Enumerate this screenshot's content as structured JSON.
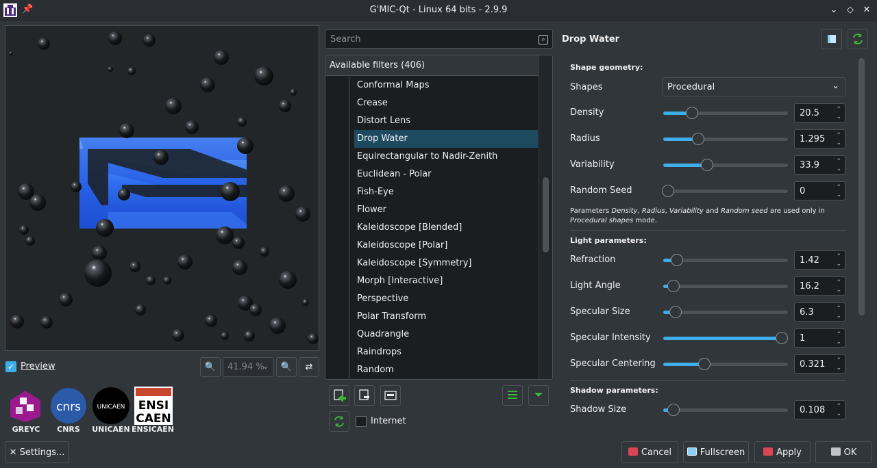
{
  "window": {
    "title": "G'MIC-Qt - Linux 64 bits - 2.9.9"
  },
  "preview": {
    "checkbox_label": "Preview",
    "zoom": "41.94 %",
    "checked": true
  },
  "logos": [
    {
      "label": "GREYC"
    },
    {
      "label": "CNRS"
    },
    {
      "label": "UNICAEN"
    },
    {
      "label": "ENSICAEN"
    }
  ],
  "logo_text": {
    "cnrs": "cnrs",
    "unicaen": "UNICAEN",
    "ensi": "ENSI",
    "caen": "CAEN"
  },
  "settings_label": "Settings...",
  "search": {
    "placeholder": "Search"
  },
  "filters": {
    "header": "Available filters (406)",
    "items": [
      "Conformal Maps",
      "Crease",
      "Distort Lens",
      "Drop Water",
      "Equirectangular to Nadir-Zenith",
      "Euclidean - Polar",
      "Fish-Eye",
      "Flower",
      "Kaleidoscope [Blended]",
      "Kaleidoscope [Polar]",
      "Kaleidoscope [Symmetry]",
      "Morph [Interactive]",
      "Perspective",
      "Polar Transform",
      "Quadrangle",
      "Raindrops",
      "Random"
    ],
    "selected": "Drop Water"
  },
  "internet_label": "Internet",
  "filter_params": {
    "name": "Drop Water",
    "shape_section": "Shape geometry:",
    "shapes_label": "Shapes",
    "shapes_value": "Procedural",
    "light_section": "Light parameters:",
    "shadow_section": "Shadow parameters:",
    "note_1": "Parameters ",
    "note_density": "Density",
    "note_c1": ", ",
    "note_radius": "Radius",
    "note_c2": ", ",
    "note_variability": "Variability",
    "note_and": " and ",
    "note_random": "Random seed",
    "note_rest": " are used only in ",
    "note_procedural": "Procedural shapes",
    "note_end": " mode.",
    "params": [
      {
        "label": "Density",
        "value": "20.5",
        "fraction": 0.23
      },
      {
        "label": "Radius",
        "value": "1.295",
        "fraction": 0.28
      },
      {
        "label": "Variability",
        "value": "33.9",
        "fraction": 0.35
      },
      {
        "label": "Random Seed",
        "value": "0",
        "fraction": 0.04
      },
      {
        "label": "Refraction",
        "value": "1.42",
        "fraction": 0.11
      },
      {
        "label": "Light Angle",
        "value": "16.2",
        "fraction": 0.08
      },
      {
        "label": "Specular Size",
        "value": "6.3",
        "fraction": 0.1
      },
      {
        "label": "Specular Intensity",
        "value": "1",
        "fraction": 0.95
      },
      {
        "label": "Specular Centering",
        "value": "0.321",
        "fraction": 0.33
      },
      {
        "label": "Shadow Size",
        "value": "0.108",
        "fraction": 0.08
      }
    ]
  },
  "buttons": {
    "cancel": "Cancel",
    "fullscreen": "Fullscreen",
    "apply": "Apply",
    "ok": "OK"
  },
  "colors": {
    "accent": "#3daee9",
    "selection": "#1e4a60",
    "background": "#31363b"
  }
}
